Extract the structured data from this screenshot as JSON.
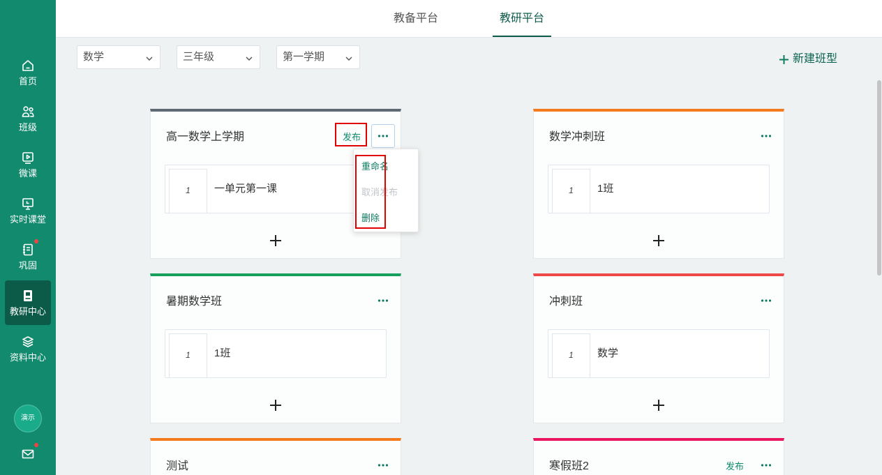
{
  "sidebar": {
    "items": [
      {
        "label": "首页",
        "icon": "home-icon"
      },
      {
        "label": "班级",
        "icon": "users-icon"
      },
      {
        "label": "微课",
        "icon": "play-icon"
      },
      {
        "label": "实时课堂",
        "icon": "presentation-icon"
      },
      {
        "label": "巩固",
        "icon": "notebook-icon",
        "badge": true
      },
      {
        "label": "教研中心",
        "icon": "book-icon",
        "active": true
      },
      {
        "label": "资料中心",
        "icon": "layers-icon"
      }
    ],
    "avatar": {
      "label": "演示"
    },
    "mail": {
      "icon": "mail-icon",
      "badge": true
    }
  },
  "header": {
    "tabs": [
      {
        "label": "教备平台",
        "active": false
      },
      {
        "label": "教研平台",
        "active": true
      }
    ]
  },
  "filters": {
    "subject": {
      "value": "数学"
    },
    "grade": {
      "value": "三年级"
    },
    "term": {
      "value": "第一学期"
    }
  },
  "toolbar": {
    "new_class_type_label": "新建班型",
    "new_icon": "plus-icon"
  },
  "cards": [
    {
      "title": "高一数学上学期",
      "publish_label": "发布",
      "accent": "#5e6973",
      "lessons": [
        {
          "index": "1",
          "name": "一单元第一课"
        }
      ]
    },
    {
      "title": "数学冲刺班",
      "accent": "#f37b1d",
      "lessons": [
        {
          "index": "1",
          "name": "1班"
        }
      ]
    },
    {
      "title": "暑期数学班",
      "accent": "#17a05d",
      "lessons": [
        {
          "index": "1",
          "name": "1班"
        }
      ]
    },
    {
      "title": "冲刺班",
      "accent": "#ef4848",
      "lessons": [
        {
          "index": "1",
          "name": "数学"
        }
      ]
    },
    {
      "title": "测试",
      "accent": "#f37b1d"
    },
    {
      "title": "寒假班2",
      "publish_label": "发布",
      "accent": "#e8175d"
    }
  ],
  "card_menu": {
    "items": [
      {
        "label": "重命名",
        "disabled": false
      },
      {
        "label": "取消发布",
        "disabled": true
      },
      {
        "label": "删除",
        "disabled": false
      }
    ]
  },
  "colors": {
    "sidebar_bg": "#128a6e",
    "sidebar_active_bg": "#0b5b48",
    "accent": "#0e7c62",
    "badge": "#f04343",
    "page_bg": "#eff2f3",
    "highlight": "#e00000"
  }
}
